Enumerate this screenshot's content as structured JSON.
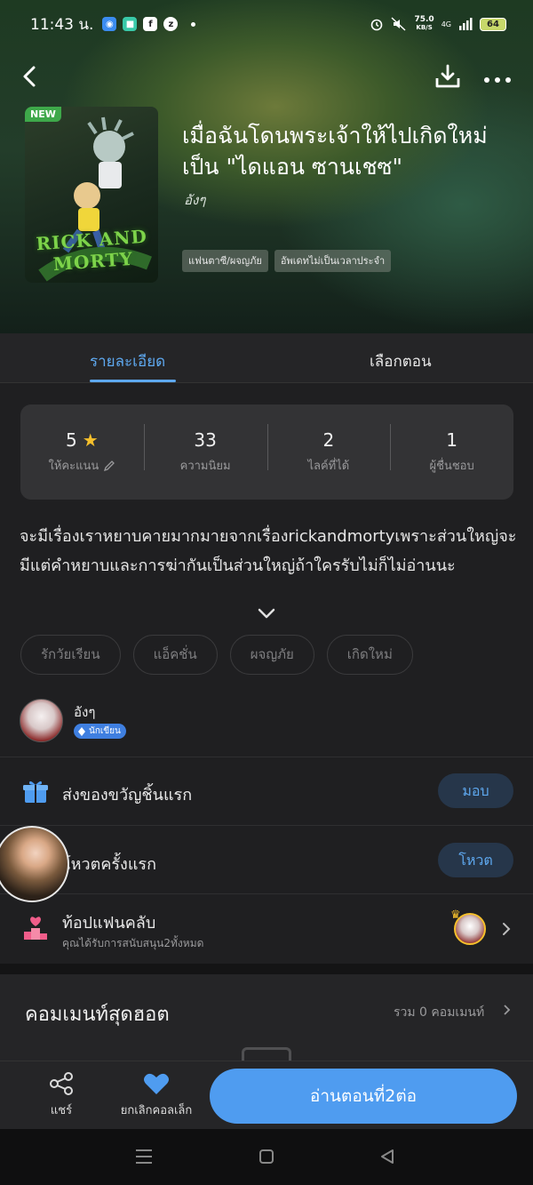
{
  "status_bar": {
    "time": "11:43 น.",
    "speed_value": "75.0",
    "speed_unit": "KB/S",
    "network": "4G",
    "battery": "64"
  },
  "header": {
    "badge": "NEW",
    "cover_logo": "RICK AND MORTY",
    "title": "เมื่อฉันโดนพระเจ้าให้ไปเกิดใหม่เป็น \"ไดแอน ซานเชซ\"",
    "author": "อังๆ",
    "tags": [
      "แฟนตาซี/ผจญภัย",
      "อัพเดทไม่เป็นเวลาประจำ"
    ]
  },
  "tabs": [
    {
      "label": "รายละเอียด",
      "active": true
    },
    {
      "label": "เลือกตอน",
      "active": false
    }
  ],
  "stats": [
    {
      "value": "5",
      "label": "ให้คะแนน"
    },
    {
      "value": "33",
      "label": "ความนิยม"
    },
    {
      "value": "2",
      "label": "ไลค์ที่ได้"
    },
    {
      "value": "1",
      "label": "ผู้ชื่นชอบ"
    }
  ],
  "description": "จะมีเรื่องเราหยาบคายมากมายจากเรื่องrickandmortyเพราะส่วนใหญ่จะมีแต่คำหยาบและการฆ่ากันเป็นส่วนใหญ่ถ้าใครรับไม่ก็ไม่อ่านนะ",
  "genres": [
    "รักวัยเรียน",
    "แอ็คชั่น",
    "ผจญภัย",
    "เกิดใหม่"
  ],
  "writer": {
    "name": "อังๆ",
    "role": "นักเขียน"
  },
  "rows": {
    "gift": {
      "label": "ส่งของขวัญชิ้นแรก",
      "button": "มอบ"
    },
    "vote": {
      "label": "โหวตครั้งแรก",
      "button": "โหวต"
    },
    "fanclub": {
      "label": "ท้อปแฟนคลับ",
      "sub": "คุณได้รับการสนับสนุน2ทั้งหมด"
    }
  },
  "comments": {
    "title": "คอมเมนท์สุดฮอต",
    "count_text": "รวม 0 คอมเมนท์"
  },
  "bottom_bar": {
    "share": "แชร์",
    "uncollect": "ยกเลิกคอลเล็ก",
    "read": "อ่านตอนที่2ต่อ"
  },
  "colors": {
    "accent": "#5ea8ef",
    "primary_button": "#4f9cf0",
    "star": "#f6c02c",
    "new_badge": "#3ea84a"
  }
}
